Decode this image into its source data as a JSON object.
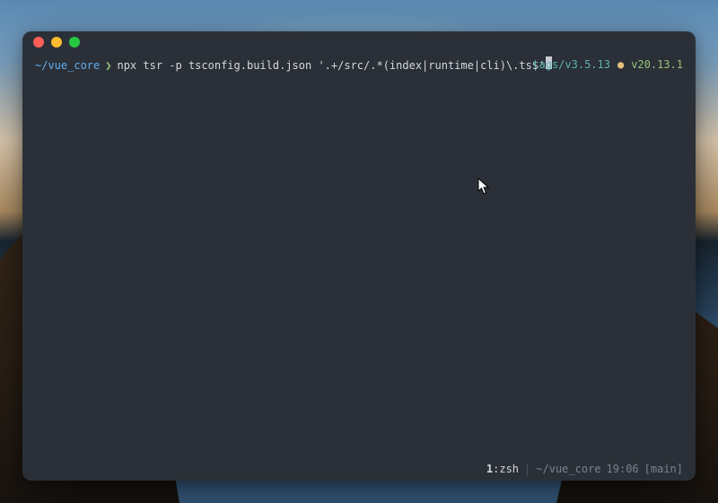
{
  "prompt": {
    "path": "~/vue_core",
    "separator": "❯",
    "command": "npx tsr -p tsconfig.build.json '.+/src/.*(index|runtime|cli)\\.ts$'"
  },
  "right_status": {
    "tag": "tags/v3.5.13",
    "node_version": "v20.13.1"
  },
  "statusbar": {
    "tab_number": "1",
    "tab_name": ":zsh",
    "divider": "|",
    "path": "~/vue_core",
    "time": "19:06",
    "branch": "[main]"
  }
}
